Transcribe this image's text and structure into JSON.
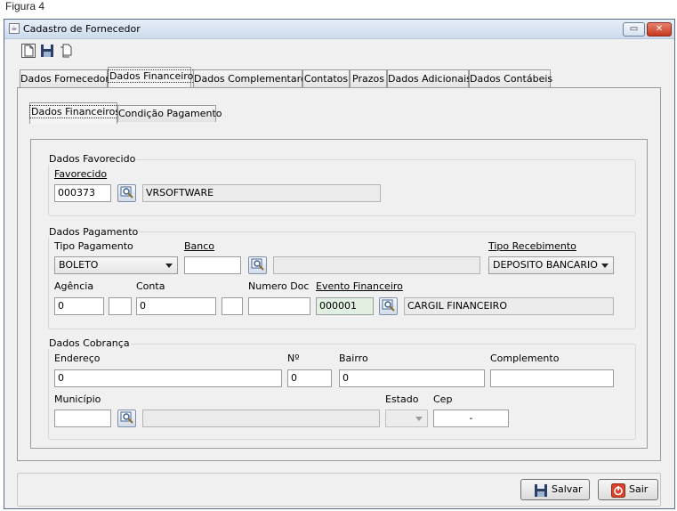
{
  "figure_caption": "Figura 4",
  "window": {
    "title": "Cadastro de Fornecedor",
    "minimize_glyph": "▭",
    "close_glyph": "✕"
  },
  "toolbar": {
    "icons": [
      "new-document-icon",
      "save-disk-icon",
      "copy-document-icon"
    ]
  },
  "main_tabs": [
    {
      "label": "Dados Fornecedor",
      "active": false
    },
    {
      "label": "Dados Financeiro",
      "active": true
    },
    {
      "label": "Dados Complementares",
      "active": false
    },
    {
      "label": "Contatos",
      "active": false
    },
    {
      "label": "Prazos",
      "active": false
    },
    {
      "label": "Dados Adicionais",
      "active": false
    },
    {
      "label": "Dados Contábeis",
      "active": false
    }
  ],
  "sub_tabs": [
    {
      "label": "Dados Financeiros",
      "active": true
    },
    {
      "label": "Condição Pagamento",
      "active": false
    }
  ],
  "favorecido_group": {
    "title": "Dados Favorecido",
    "label": "Favorecido",
    "code": "000373",
    "name": "VRSOFTWARE"
  },
  "pagamento_group": {
    "title": "Dados Pagamento",
    "tipo_pagamento_label": "Tipo Pagamento",
    "tipo_pagamento_value": "BOLETO",
    "banco_label": "Banco",
    "banco_code": "",
    "banco_name": "",
    "tipo_recebimento_label": "Tipo Recebimento",
    "tipo_recebimento_value": "DEPOSITO BANCARIO",
    "agencia_label": "Agência",
    "agencia_value": "0",
    "agencia_digito": "",
    "conta_label": "Conta",
    "conta_value": "0",
    "conta_digito": "",
    "numero_doc_label": "Numero Doc",
    "numero_doc_value": "",
    "evento_label": "Evento Financeiro",
    "evento_code": "000001",
    "evento_name": "CARGIL FINANCEIRO"
  },
  "cobranca_group": {
    "title": "Dados Cobrança",
    "endereco_label": "Endereço",
    "endereco_value": "0",
    "numero_label": "Nº",
    "numero_value": "0",
    "bairro_label": "Bairro",
    "bairro_value": "0",
    "complemento_label": "Complemento",
    "complemento_value": "",
    "municipio_label": "Município",
    "municipio_code": "",
    "municipio_name": "",
    "estado_label": "Estado",
    "estado_value": "",
    "cep_label": "Cep",
    "cep_value": "-"
  },
  "buttons": {
    "save_label": "Salvar",
    "exit_label": "Sair"
  },
  "colors": {
    "title_gradient_top": "#e6eef8",
    "close_button": "#c6391c",
    "readonly_green": "#e1f0e0"
  }
}
